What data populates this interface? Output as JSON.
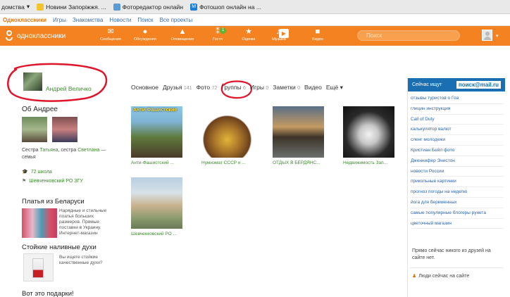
{
  "bookmarks": [
    "домства",
    "Новини Запоріжжя. ...",
    "Фоторедактор онлайн",
    "Фотошоп онлайн на ..."
  ],
  "site_nav": [
    "Одноклассники",
    "Игры",
    "Знакомства",
    "Новости",
    "Поиск",
    "Все проекты"
  ],
  "header": {
    "logo_text": "одноклассники",
    "nav": [
      {
        "label": "Сообщения",
        "icon": "mail-icon"
      },
      {
        "label": "Обсуждения",
        "icon": "chat-icon"
      },
      {
        "label": "Оповещения",
        "icon": "bell-icon"
      },
      {
        "label": "Гости",
        "icon": "footprints-icon",
        "badge": "1"
      },
      {
        "label": "Оценки",
        "icon": "rating-icon"
      },
      {
        "label": "Музыка",
        "icon": "music-icon"
      },
      {
        "label": "Видео",
        "icon": "video-camera-icon"
      }
    ],
    "search_placeholder": "Поиск"
  },
  "profile": {
    "name": "Андрей Величко",
    "about_title": "Об Андрее",
    "relatives_prefix": "Сестра ",
    "relative1": "Татьяна",
    "relatives_mid": ", сестра ",
    "relative2": "Светлана",
    "relatives_suffix": " — семья",
    "school": "72 школа",
    "group": "Шевченковский РО ЗГУ"
  },
  "ads": [
    {
      "title": "Платья из Беларуси",
      "text": "Нарядные и стильные платья больших размеров. Прямые поставки в Украину. Интернет-магазин"
    },
    {
      "title": "Стойкие наливные духи",
      "text": "Вы ищете стойкие качественные духи?"
    },
    {
      "title": "Вот это подарки!",
      "text": ""
    }
  ],
  "tabs": [
    {
      "label": "Основное",
      "count": ""
    },
    {
      "label": "Друзья",
      "count": "141"
    },
    {
      "label": "Фото",
      "count": "72"
    },
    {
      "label": "Группы",
      "count": "6"
    },
    {
      "label": "Игры",
      "count": "0"
    },
    {
      "label": "Заметки",
      "count": "0"
    },
    {
      "label": "Видео",
      "count": ""
    },
    {
      "label": "Ещё ▾",
      "count": ""
    }
  ],
  "groups": [
    {
      "caption": "Анти-Фашистский ...",
      "thumb_label": "Анти-Фашистские"
    },
    {
      "caption": "Нумизмат СССР и ..."
    },
    {
      "caption": "ОТДЫХ В БЕРДЯНС..."
    },
    {
      "caption": "Недвижимость Зап..."
    },
    {
      "caption": "Шевченковский РО ..."
    }
  ],
  "right_panel": {
    "title": "Сейчас ищут",
    "logo": "поиск@mail.ru",
    "items": [
      "отзывы туристов о Гоа",
      "глицин инструкция",
      "Call of Duty",
      "калькулятор валют",
      "сленг молодежи",
      "Кристиан Бейл фото",
      "Дженнифер Энистон",
      "новости России",
      "прикольные картинки",
      "прогноз погоды на неделю",
      "йога для беременных",
      "самые популярные блогеры рунета",
      "цветочный магазин"
    ],
    "friends_text": "Прямо сейчас никого из друзей на сайте нет.",
    "people_now": "Люди сейчас на сайте"
  },
  "colors": {
    "header": "#f58220",
    "accent_green": "#3d8a2e",
    "annotation_red": "#e0142a",
    "mail_blue": "#1a6fb2"
  }
}
